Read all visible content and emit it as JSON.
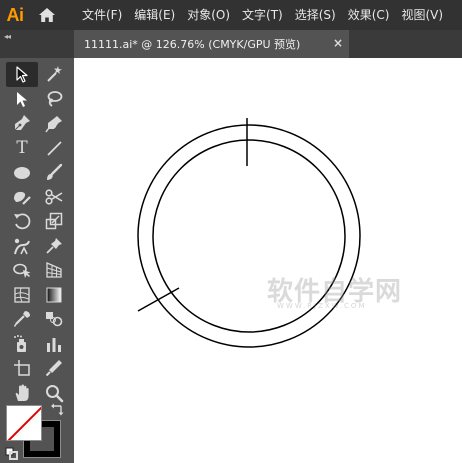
{
  "app": {
    "logo_text": "Ai",
    "icons": {
      "home": "home-icon"
    }
  },
  "menubar": {
    "items": [
      "文件(F)",
      "编辑(E)",
      "对象(O)",
      "文字(T)",
      "选择(S)",
      "效果(C)",
      "视图(V)"
    ]
  },
  "tabrow": {
    "collapse_label": "◂◂",
    "document_tab": {
      "label": "11111.ai* @ 126.76% (CMYK/GPU 预览)",
      "close_label": "×"
    }
  },
  "toolbar": {
    "type_tool_label": "T",
    "tools": [
      "selection-tool",
      "magic-wand-tool",
      "direct-selection-tool",
      "lasso-tool",
      "pen-tool",
      "curvature-tool",
      "type-tool",
      "line-segment-tool",
      "ellipse-tool",
      "paintbrush-tool",
      "shaper-tool",
      "scissors-tool",
      "rotate-tool",
      "scale-tool",
      "puppet-warp-tool",
      "pin-tool",
      "shape-builder-tool",
      "perspective-grid-tool",
      "mesh-tool",
      "gradient-tool",
      "eyedropper-tool",
      "blend-tool",
      "symbol-sprayer-tool",
      "column-graph-tool",
      "artboard-tool",
      "slice-tool",
      "hand-tool",
      "zoom-tool"
    ],
    "fill_color": "#ffffff",
    "stroke_color": "#000000"
  },
  "canvas": {
    "background": "#ffffff",
    "stroke_color": "#000000",
    "watermark": "软件自学网",
    "watermark_sub": "WWW.RJZXW.COM"
  },
  "colors": {
    "menubar_bg": "#323232",
    "panel_bg": "#535353",
    "logo_orange": "#ff9a00"
  }
}
